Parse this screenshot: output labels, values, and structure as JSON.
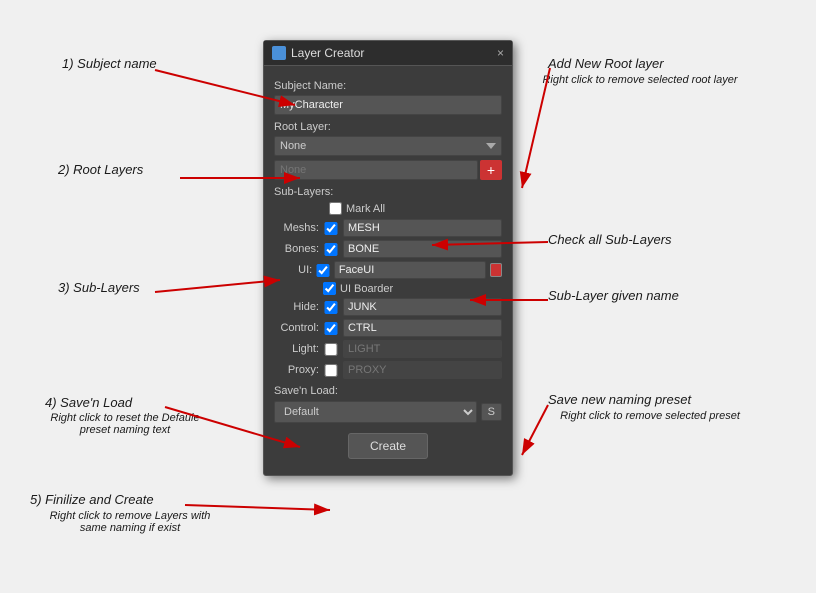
{
  "dialog": {
    "title": "Layer Creator",
    "close_label": "×",
    "subject_name_label": "Subject Name:",
    "subject_name_value": "MyCharacter",
    "root_layer_label": "Root Layer:",
    "root_layer_option": "None",
    "none_placeholder": "None",
    "add_button_label": "+",
    "sublayers_label": "Sub-Layers:",
    "mark_all_label": "Mark All",
    "sublayers": [
      {
        "name": "Meshs:",
        "checked": true,
        "value": "MESH",
        "has_color": false,
        "disabled": false
      },
      {
        "name": "Bones:",
        "checked": true,
        "value": "BONE",
        "has_color": false,
        "disabled": false
      },
      {
        "name": "UI:",
        "checked": true,
        "value": "FaceUI",
        "has_color": true,
        "disabled": false
      },
      {
        "name": "Hide:",
        "checked": true,
        "value": "JUNK",
        "has_color": false,
        "disabled": false
      },
      {
        "name": "Control:",
        "checked": true,
        "value": "CTRL",
        "has_color": false,
        "disabled": false
      },
      {
        "name": "Light:",
        "checked": false,
        "value": "LIGHT",
        "has_color": false,
        "disabled": true
      },
      {
        "name": "Proxy:",
        "checked": false,
        "value": "PROXY",
        "has_color": false,
        "disabled": true
      }
    ],
    "ui_boarder_label": "UI Boarder",
    "ui_boarder_checked": true,
    "saveln_label": "Save'n Load:",
    "saveln_option": "Default",
    "saveln_button_label": "S",
    "create_button_label": "Create"
  },
  "annotations": {
    "subject_name": "1) Subject name",
    "root_layers": "2) Root Layers",
    "sub_layers": "3) Sub-Layers",
    "save_load": "4) Save'n Load",
    "save_load_sub": "Right click to reset the Defaule\npreset naming text",
    "finalize": "5) Finilize and Create",
    "finalize_sub": "Right click to remove Layers with\nsame naming if exist",
    "add_new_root": "Add New Root layer",
    "add_new_root_sub": "Right click to remove selected root layer",
    "check_all_sub": "Check all Sub-Layers",
    "sublayer_name": "Sub-Layer given name",
    "save_preset": "Save new naming preset",
    "save_preset_sub": "Right click to remove selected preset"
  }
}
